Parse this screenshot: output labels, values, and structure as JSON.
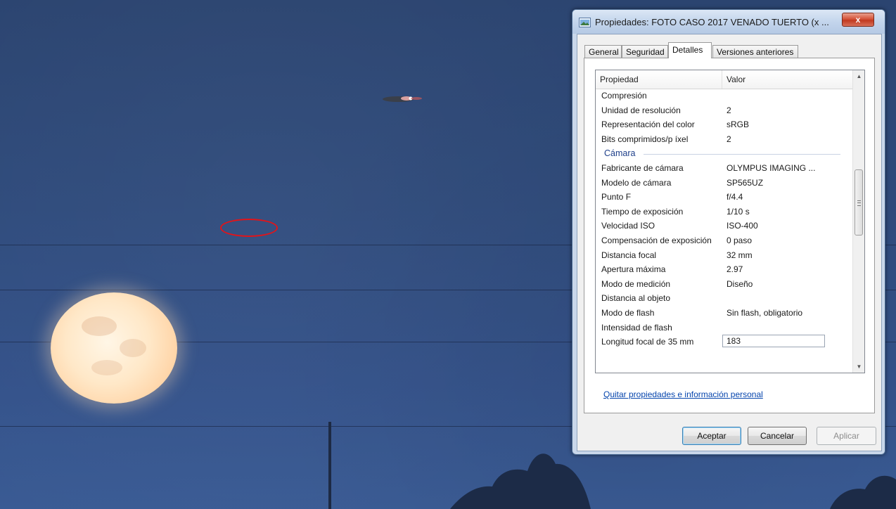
{
  "dialog": {
    "title": "Propiedades: FOTO CASO 2017 VENADO TUERTO (x ...",
    "close_label": "x",
    "tabs": [
      {
        "label": "General"
      },
      {
        "label": "Seguridad"
      },
      {
        "label": "Detalles",
        "active": true
      },
      {
        "label": "Versiones anteriores"
      }
    ],
    "list": {
      "header_property": "Propiedad",
      "header_value": "Valor",
      "rows": [
        {
          "property": "Compresión",
          "value": ""
        },
        {
          "property": "Unidad de resolución",
          "value": "2"
        },
        {
          "property": "Representación del color",
          "value": "sRGB"
        },
        {
          "property": "Bits comprimidos/p íxel",
          "value": "2"
        },
        {
          "group": "Cámara"
        },
        {
          "property": "Fabricante de cámara",
          "value": "OLYMPUS IMAGING ..."
        },
        {
          "property": "Modelo de cámara",
          "value": "SP565UZ"
        },
        {
          "property": "Punto F",
          "value": "f/4.4"
        },
        {
          "property": "Tiempo de exposición",
          "value": "1/10 s"
        },
        {
          "property": "Velocidad ISO",
          "value": "ISO-400"
        },
        {
          "property": "Compensación de exposición",
          "value": "0 paso"
        },
        {
          "property": "Distancia focal",
          "value": "32 mm"
        },
        {
          "property": "Apertura máxima",
          "value": "2.97"
        },
        {
          "property": "Modo de medición",
          "value": "Diseño"
        },
        {
          "property": "Distancia al objeto",
          "value": ""
        },
        {
          "property": "Modo de flash",
          "value": "Sin flash, obligatorio"
        },
        {
          "property": "Intensidad de flash",
          "value": ""
        },
        {
          "property": "Longitud focal de 35 mm",
          "value": "183",
          "editing": true
        }
      ]
    },
    "remove_link": "Quitar propiedades e información personal",
    "buttons": {
      "ok": "Aceptar",
      "cancel": "Cancelar",
      "apply": "Aplicar"
    }
  },
  "icons": {
    "dialog_icon": "image-file-icon",
    "close": "close-icon",
    "scroll_up": "scroll-up-arrow-icon",
    "scroll_down": "scroll-down-arrow-icon"
  },
  "colors": {
    "sky": "#2f4b7c",
    "moon": "#ffe8c8",
    "highlight_circle": "#e1141a",
    "link": "#0645ad",
    "group_heading": "#1e3f8a"
  }
}
